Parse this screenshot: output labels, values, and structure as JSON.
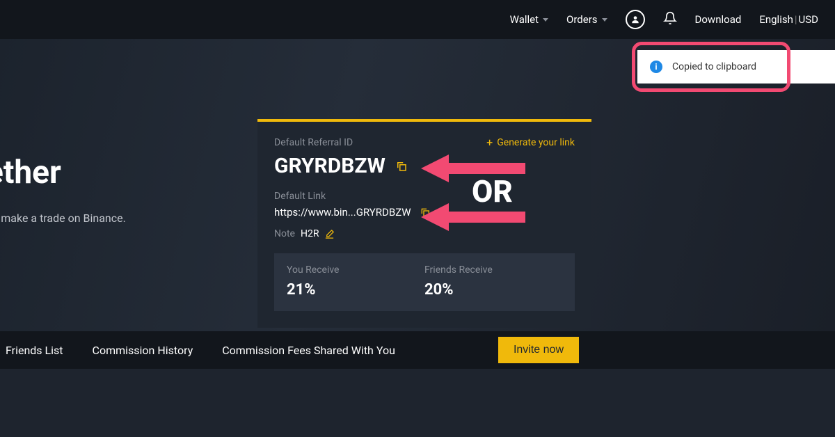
{
  "topbar": {
    "wallet": "Wallet",
    "orders": "Orders",
    "download": "Download",
    "language": "English",
    "currency": "USD"
  },
  "toast": {
    "message": "Copied to clipboard"
  },
  "hero": {
    "title_fragment": "ether",
    "subtitle_fragment": "ds make a trade on Binance."
  },
  "card": {
    "default_ref_label": "Default Referral ID",
    "generate_link": "Generate your link",
    "ref_id": "GRYRDBZW",
    "default_link_label": "Default Link",
    "default_link_value": "https://www.bin...GRYRDBZW",
    "note_label": "Note",
    "note_value": "H2R",
    "you_receive_label": "You Receive",
    "you_receive_value": "21%",
    "friends_receive_label": "Friends Receive",
    "friends_receive_value": "20%"
  },
  "annotation": {
    "or": "OR"
  },
  "tabs": {
    "friends_list": "Friends List",
    "commission_history": "Commission History",
    "commission_fees": "Commission Fees Shared With You",
    "invite": "Invite now"
  },
  "colors": {
    "accent": "#f0b90b",
    "annotation": "#f24a72"
  }
}
